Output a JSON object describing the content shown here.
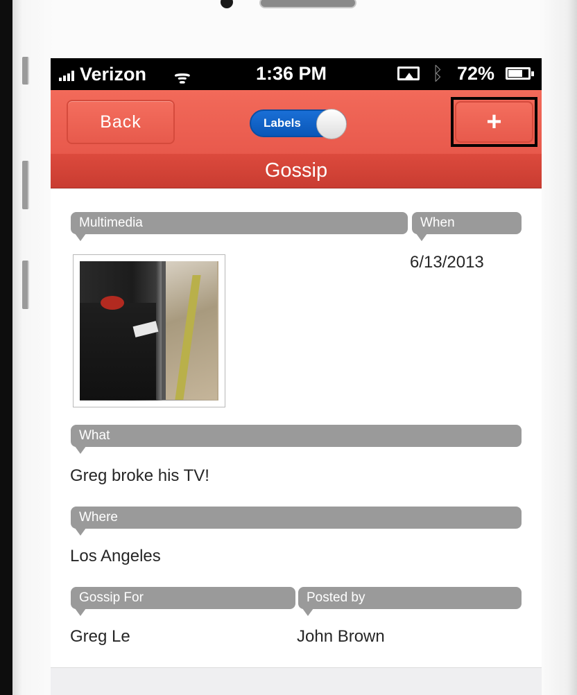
{
  "status_bar": {
    "carrier": "Verizon",
    "wifi_icon": "wifi-icon",
    "time": "1:36 PM",
    "airplay_icon": "airplay-icon",
    "bluetooth_icon": "bluetooth-icon",
    "battery": "72%",
    "battery_level": 0.72
  },
  "nav": {
    "back_label": "Back",
    "toggle_label": "Labels",
    "toggle_on": true,
    "add_label": "+"
  },
  "page": {
    "title": "Gossip"
  },
  "fields": {
    "multimedia_label": "Multimedia",
    "when_label": "When",
    "when_value": "6/13/2013",
    "what_label": "What",
    "what_value": "Greg broke his TV!",
    "where_label": "Where",
    "where_value": "Los Angeles",
    "gossip_for_label": "Gossip For",
    "gossip_for_value": "Greg Le",
    "posted_by_label": "Posted by",
    "posted_by_value": "John Brown"
  },
  "colors": {
    "nav_red": "#ec6252",
    "title_red": "#d24537",
    "toggle_blue": "#0f60c4",
    "label_gray": "#9a9a9a"
  }
}
